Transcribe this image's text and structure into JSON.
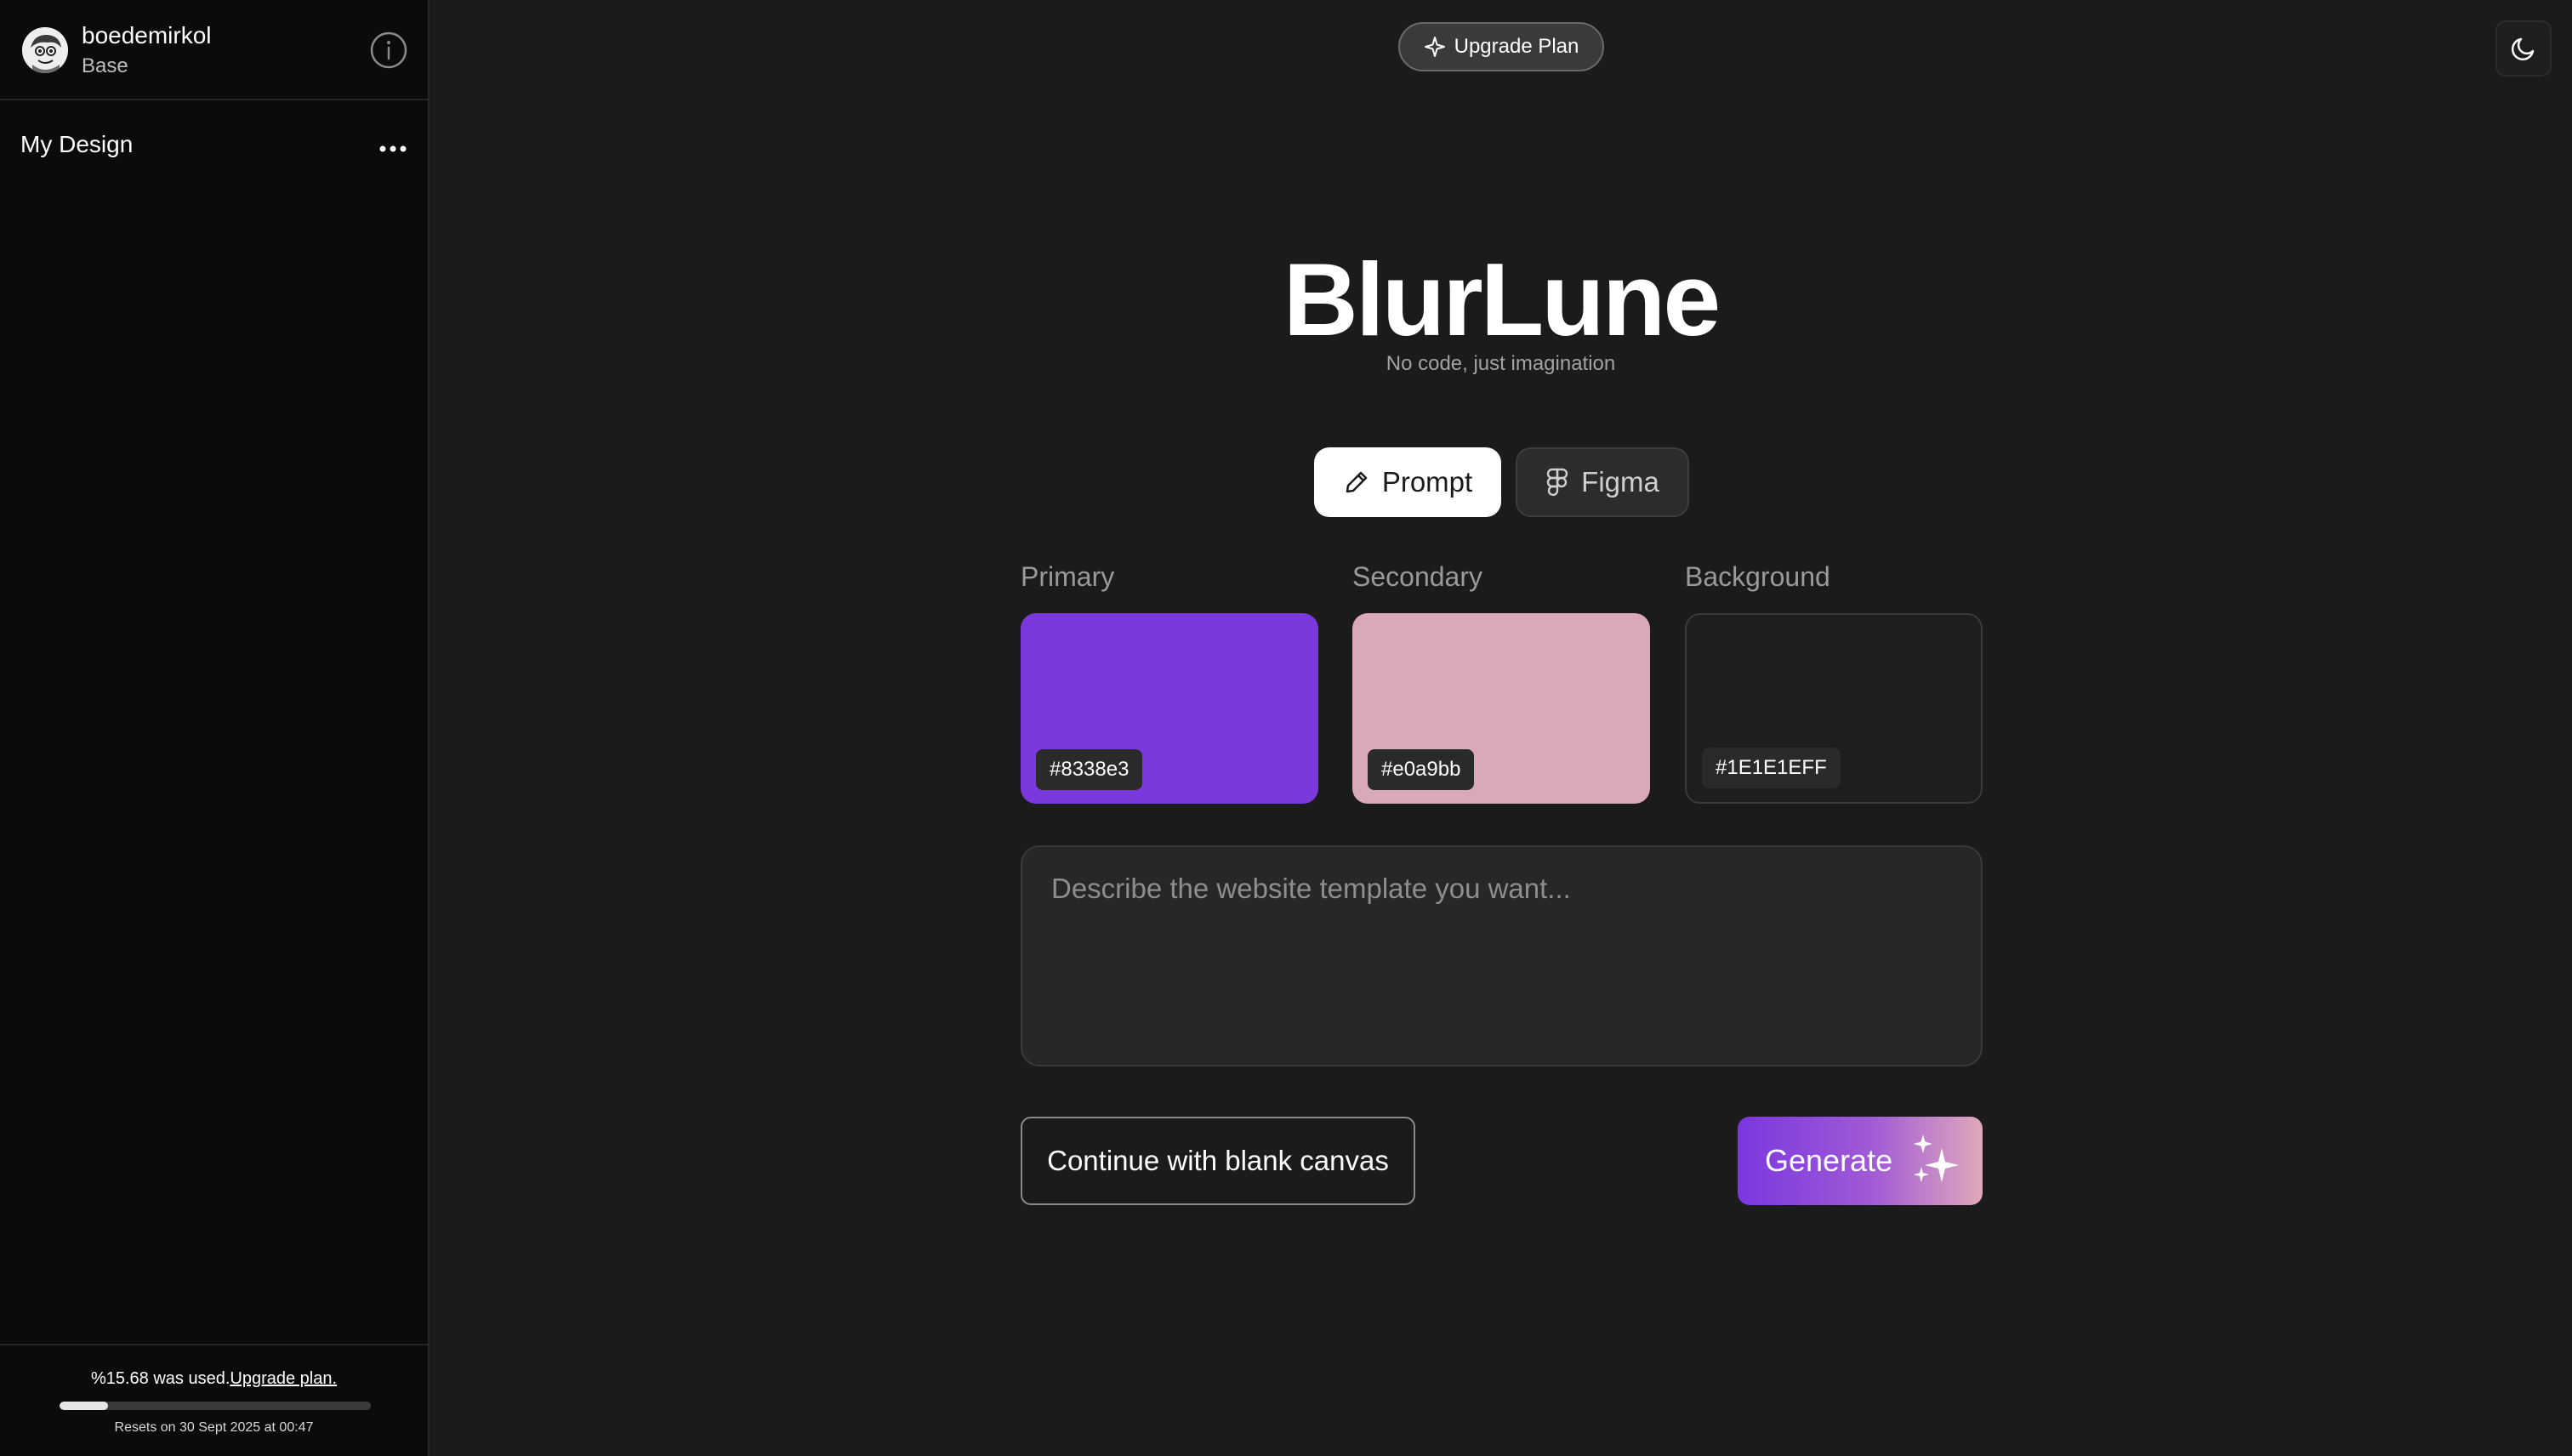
{
  "sidebar": {
    "username": "boedemirkol",
    "plan": "Base",
    "design_item": "My Design",
    "usage": {
      "text": "%15.68 was used.",
      "upgrade_link": "Upgrade plan.",
      "fraction": 0.1568,
      "reset": "Resets on 30 Sept 2025 at 00:47"
    }
  },
  "header": {
    "upgrade_label": "Upgrade Plan"
  },
  "hero": {
    "brand": "BlurLune",
    "tagline": "No code, just imagination"
  },
  "tabs": [
    {
      "label": "Prompt",
      "icon": "pencil-icon",
      "active": true
    },
    {
      "label": "Figma",
      "icon": "figma-icon",
      "active": false
    }
  ],
  "colors": [
    {
      "label": "Primary",
      "value": "#8338e3",
      "swatch": "#7b38dc"
    },
    {
      "label": "Secondary",
      "value": "#e0a9bb",
      "swatch": "#d9a9ba"
    },
    {
      "label": "Background",
      "value": "#1E1E1EFF",
      "swatch": "#1e1e1e"
    }
  ],
  "prompt": {
    "placeholder": "Describe the website template you want..."
  },
  "actions": {
    "blank_canvas": "Continue with blank canvas",
    "generate": "Generate"
  }
}
